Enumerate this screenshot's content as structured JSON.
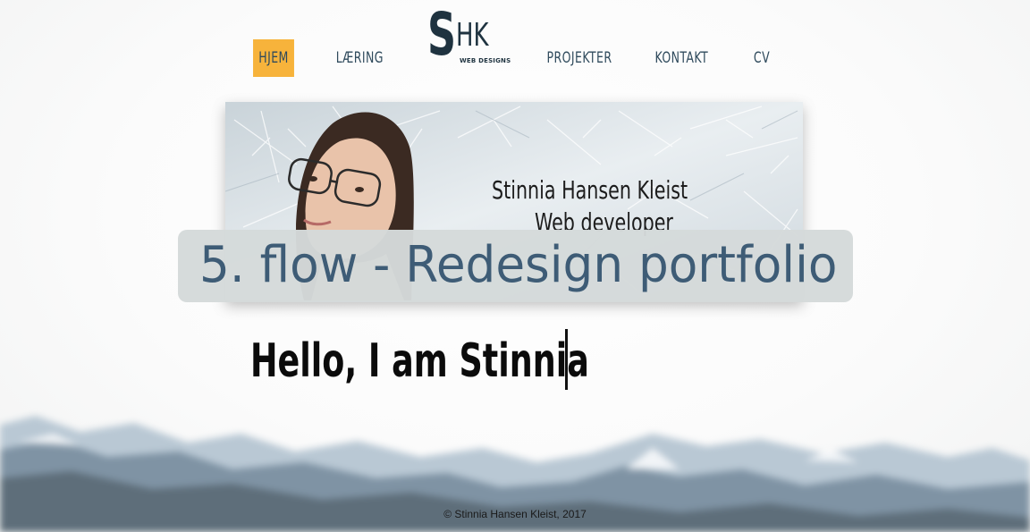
{
  "nav": {
    "items": [
      {
        "label": "HJEM",
        "active": true
      },
      {
        "label": "LÆRING",
        "active": false
      },
      {
        "label": "PROJEKTER",
        "active": false
      },
      {
        "label": "KONTAKT",
        "active": false
      },
      {
        "label": "CV",
        "active": false
      }
    ],
    "logo": {
      "letters_big": "S",
      "letters_small": "HK",
      "subtitle": "WEB DESIGNS"
    }
  },
  "hero": {
    "name": "Stinnia Hansen Kleist",
    "role": "Web developer"
  },
  "banner": {
    "text": "5. flow - Redesign portfolio"
  },
  "headline": "Hello, I am Stinnia",
  "footer": "© Stinnia Hansen Kleist, 2017",
  "colors": {
    "accent": "#f7b33b",
    "nav_text": "#2f4a5c",
    "banner_text": "#3e5c76",
    "banner_bg": "#d5dada"
  }
}
